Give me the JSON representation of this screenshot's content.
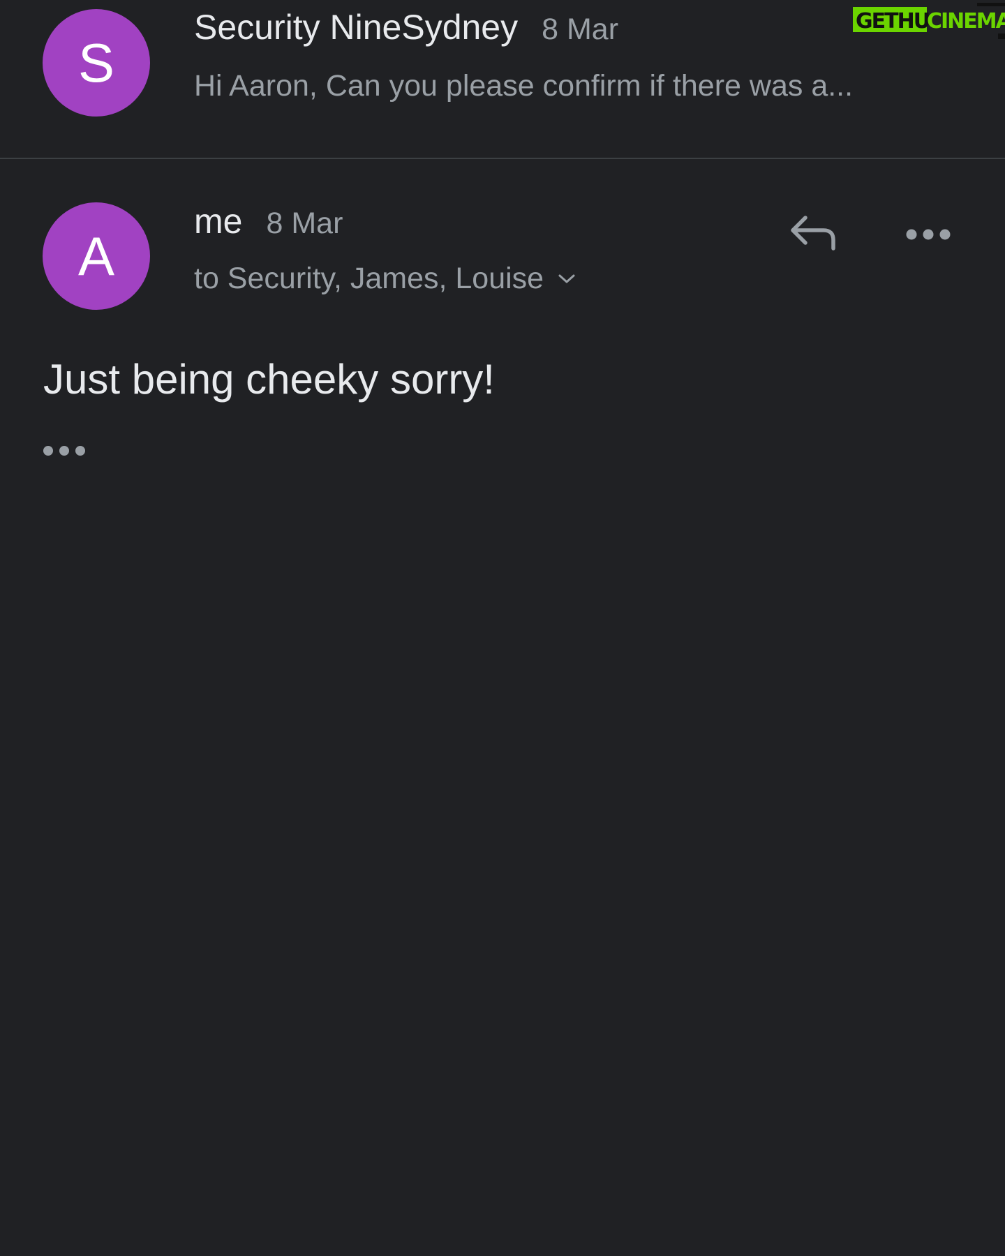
{
  "watermark": {
    "text": "GETHUCINEMA"
  },
  "thread": {
    "messages": [
      {
        "avatar_letter": "S",
        "sender": "Security NineSydney",
        "date": "8 Mar",
        "snippet": "Hi Aaron, Can you please confirm if there was a...",
        "avatar_color": "#a142c2"
      },
      {
        "avatar_letter": "A",
        "sender": "me",
        "date": "8 Mar",
        "recipients": "to Security, James, Louise",
        "body": "Just being cheeky sorry!",
        "avatar_color": "#a142c2"
      }
    ]
  },
  "icons": {
    "reply": "reply-icon",
    "more": "more-options-icon",
    "expand_recipients": "chevron-down-icon",
    "trimmed_content": "trimmed-content-icon"
  }
}
